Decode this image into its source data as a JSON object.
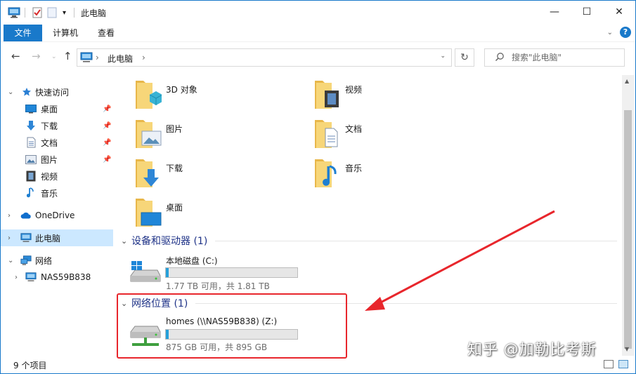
{
  "window": {
    "title": "此电脑",
    "controls": {
      "minimize": "—",
      "maximize": "☐",
      "close": "✕"
    },
    "accent": "#1979ca"
  },
  "ribbon": {
    "tabs": [
      "文件",
      "计算机",
      "查看"
    ],
    "help": "?"
  },
  "address": {
    "path": "此电脑",
    "separator": "›"
  },
  "search": {
    "placeholder": "搜索\"此电脑\""
  },
  "nav": {
    "quick_access": "快速访问",
    "quick_items": [
      "桌面",
      "下载",
      "文档",
      "图片",
      "视频",
      "音乐"
    ],
    "onedrive": "OneDrive",
    "this_pc": "此电脑",
    "network": "网络",
    "nas": "NAS59B838"
  },
  "folders": [
    "3D 对象",
    "视频",
    "图片",
    "文档",
    "下载",
    "音乐",
    "桌面"
  ],
  "groups": {
    "devices": "设备和驱动器 (1)",
    "network": "网络位置 (1)"
  },
  "drives": [
    {
      "name": "本地磁盘 (C:)",
      "space": "1.77 TB 可用，共 1.81 TB",
      "used_fraction": 0.022
    },
    {
      "name": "homes (\\\\NAS59B838) (Z:)",
      "space": "875 GB 可用，共 895 GB",
      "used_fraction": 0.022
    }
  ],
  "status": {
    "items": "9 个项目"
  },
  "watermark": "知乎 @加勒比考斯",
  "annotation_color": "#e8262c"
}
